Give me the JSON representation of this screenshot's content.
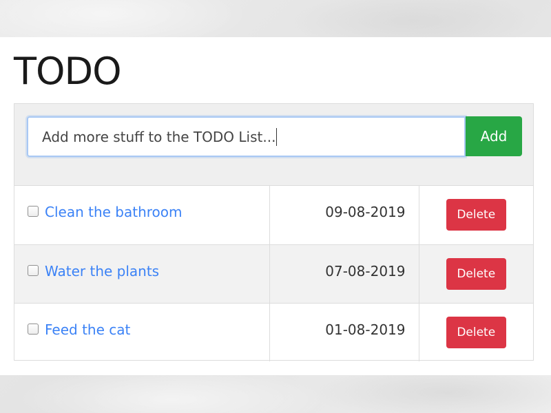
{
  "app": {
    "title": "TODO"
  },
  "add_bar": {
    "input_value": "Add more stuff to the TODO List...",
    "add_label": "Add"
  },
  "todos": [
    {
      "label": "Clean the bathroom",
      "date": "09-08-2019",
      "checked": false,
      "delete_label": "Delete"
    },
    {
      "label": "Water the plants",
      "date": "07-08-2019",
      "checked": false,
      "delete_label": "Delete"
    },
    {
      "label": "Feed the cat",
      "date": "01-08-2019",
      "checked": false,
      "delete_label": "Delete"
    }
  ],
  "colors": {
    "add_button": "#28a745",
    "delete_button": "#dc3545",
    "link": "#3b82f6",
    "input_focus_border": "#a8c8f4"
  }
}
